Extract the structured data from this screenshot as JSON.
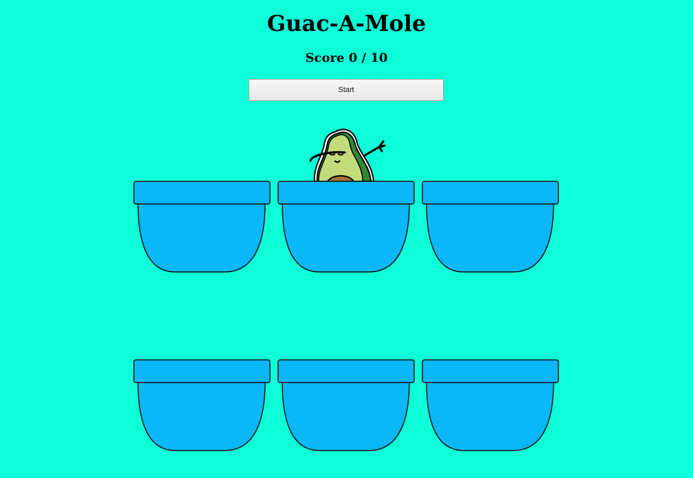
{
  "game": {
    "title": "Guac-A-Mole",
    "score_text": "Score 0 / 10",
    "start_label": "Start"
  },
  "colors": {
    "background": "#0dffd7",
    "pot": "#0ab7f7",
    "pot_outline": "#111111",
    "avocado_skin": "#2f8a34",
    "avocado_flesh": "#c2dc7c",
    "avocado_pit": "#a9713a"
  },
  "holes": [
    {
      "id": "hole-1",
      "mole_visible": false
    },
    {
      "id": "hole-2",
      "mole_visible": true
    },
    {
      "id": "hole-3",
      "mole_visible": false
    },
    {
      "id": "hole-4",
      "mole_visible": false
    },
    {
      "id": "hole-5",
      "mole_visible": false
    },
    {
      "id": "hole-6",
      "mole_visible": false
    }
  ]
}
